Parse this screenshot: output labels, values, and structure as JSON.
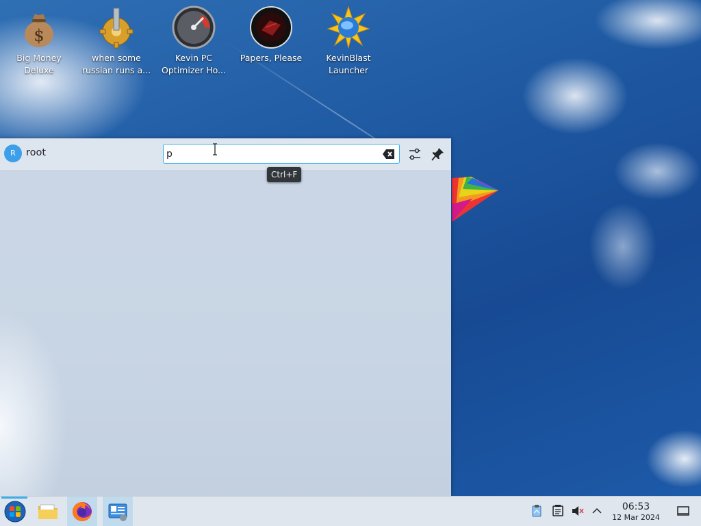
{
  "desktop": {
    "icons": [
      {
        "label_line1": "Big Money",
        "label_line2": "Deluxe",
        "icon": "money-bag-icon"
      },
      {
        "label_line1": "when some",
        "label_line2": "russian runs a...",
        "icon": "gear-icon"
      },
      {
        "label_line1": "Kevin PC",
        "label_line2": "Optimizer Ho...",
        "icon": "speedometer-icon"
      },
      {
        "label_line1": "Papers, Please",
        "label_line2": "",
        "icon": "papers-please-icon"
      },
      {
        "label_line1": "KevinBlast",
        "label_line2": "Launcher",
        "icon": "blast-launcher-icon"
      }
    ]
  },
  "launcher": {
    "user": {
      "avatar_letter": "R",
      "name": "root"
    },
    "search": {
      "value": "p",
      "tooltip": "Ctrl+F"
    }
  },
  "taskbar": {
    "apps": [
      "start-menu-icon",
      "file-manager-icon",
      "firefox-icon",
      "system-settings-icon"
    ],
    "tray": [
      "clipboard-icon",
      "notes-icon",
      "volume-muted-icon",
      "chevron-up-icon",
      "show-desktop-icon"
    ],
    "clock": {
      "time": "06:53",
      "date": "12 Mar 2024"
    }
  },
  "colors": {
    "accent": "#3daee9",
    "panel": "#dde5ef",
    "taskbar": "#dfe6ee"
  }
}
